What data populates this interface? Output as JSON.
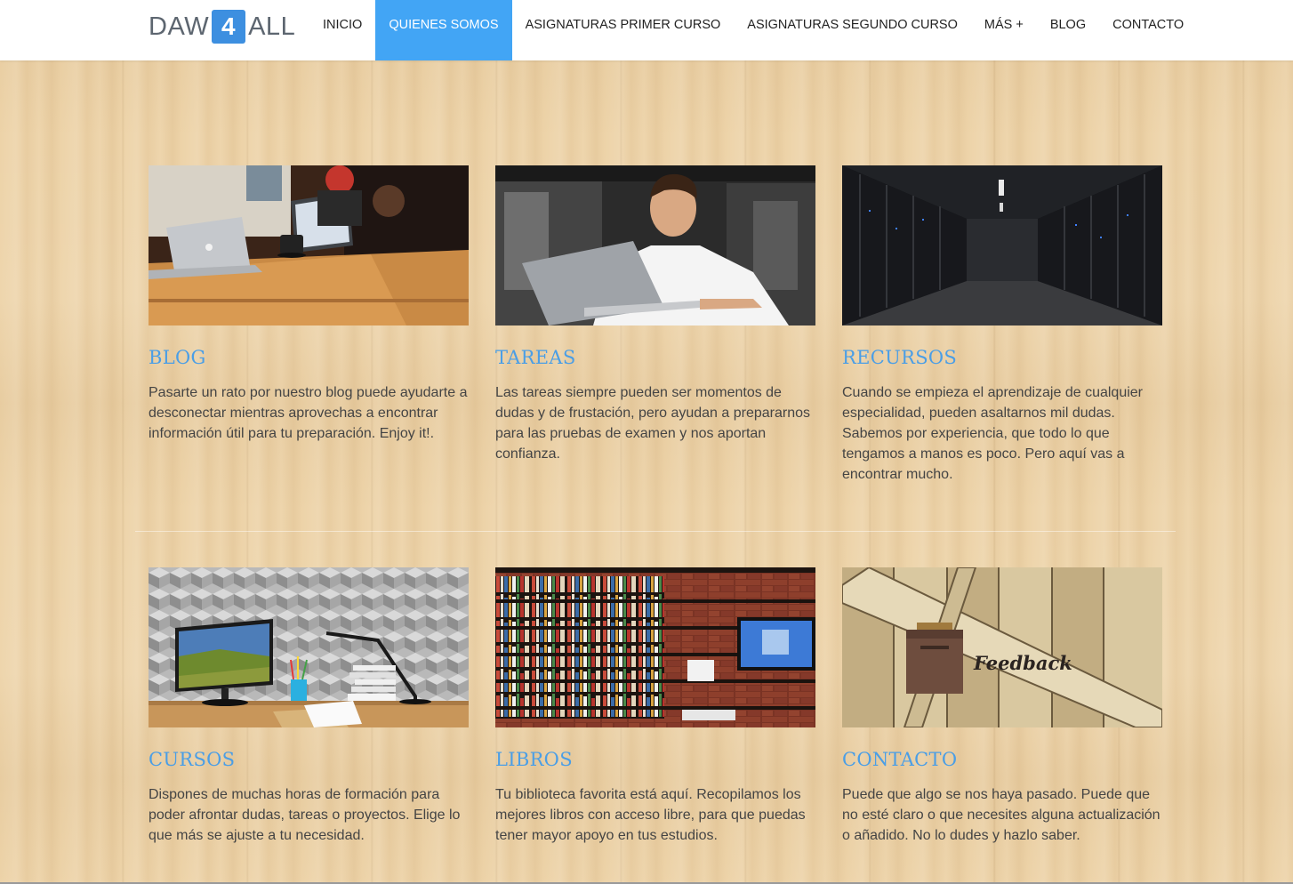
{
  "brand": {
    "left": "DAW",
    "middle": "4",
    "right": "ALL"
  },
  "nav": {
    "items": [
      {
        "label": "INICIO",
        "active": false
      },
      {
        "label": "QUIENES SOMOS",
        "active": true
      },
      {
        "label": "ASIGNATURAS PRIMER CURSO",
        "active": false
      },
      {
        "label": "ASIGNATURAS SEGUNDO CURSO",
        "active": false
      },
      {
        "label": "MÁS +",
        "active": false
      },
      {
        "label": "BLOG",
        "active": false
      },
      {
        "label": "CONTACTO",
        "active": false
      }
    ]
  },
  "cards": [
    {
      "title": "BLOG",
      "image": "laptops-on-cafe-table-photo",
      "text": "Pasarte un rato por nuestro blog puede ayudarte a desconectar mientras aprovechas a encontrar información útil para tu preparación. Enjoy it!."
    },
    {
      "title": "TAREAS",
      "image": "man-with-laptop-photo",
      "text": "Las tareas siempre pueden ser momentos de dudas y de frustación, pero ayudan a prepararnos para las pruebas de examen y nos aportan confianza."
    },
    {
      "title": "RECURSOS",
      "image": "server-room-photo",
      "text": "Cuando se empieza el aprendizaje de cualquier especialidad, pueden asaltarnos mil dudas. Sabemos por experiencia, que todo lo que tengamos a manos es poco. Pero aquí vas a encontrar mucho."
    },
    {
      "title": "CURSOS",
      "image": "desk-with-monitor-illustration",
      "text": "Dispones de muchas horas de formación para poder afrontar dudas, tareas o proyectos. Elige lo que más se ajuste a tu necesidad."
    },
    {
      "title": "LIBROS",
      "image": "bookshelf-photo",
      "text": "Tu biblioteca favorita está aquí. Recopilamos los mejores libros con acceso libre, para que puedas tener mayor apoyo en tus estudios."
    },
    {
      "title": "CONTACTO",
      "image": "feedback-mailbox-photo",
      "image_text": "Feedback",
      "text": "Puede que algo se nos haya pasado. Puede que no esté claro o que necesites alguna actualización o añadido. No lo dudes y hazlo saber."
    }
  ],
  "colors": {
    "accent": "#42a5f5",
    "heading": "#4a9ee6",
    "body_text": "#444444",
    "background_wood": "#edd3a8"
  }
}
